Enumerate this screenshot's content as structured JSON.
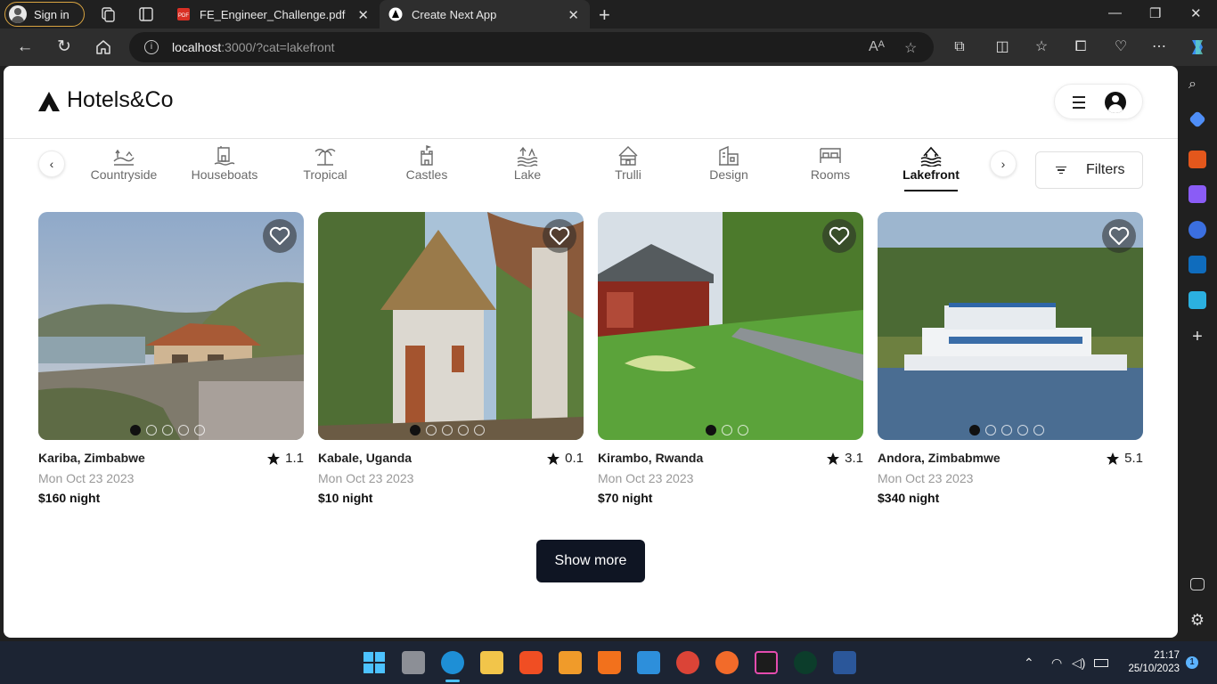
{
  "browser": {
    "signin_label": "Sign in",
    "tabs": [
      {
        "title": "FE_Engineer_Challenge.pdf",
        "icon": "pdf-icon"
      },
      {
        "title": "Create Next App",
        "icon": "nextjs-icon",
        "active": true
      }
    ],
    "url_host": "localhost",
    "url_rest": ":3000/?cat=lakefront"
  },
  "site": {
    "logo_text": "Hotels&Co",
    "filters_label": "Filters",
    "show_more_label": "Show more",
    "categories": [
      {
        "label": "Countryside",
        "icon": "countryside-icon"
      },
      {
        "label": "Houseboats",
        "icon": "houseboat-icon"
      },
      {
        "label": "Tropical",
        "icon": "palm-tree-icon"
      },
      {
        "label": "Castles",
        "icon": "castle-icon"
      },
      {
        "label": "Lake",
        "icon": "lake-icon"
      },
      {
        "label": "Trulli",
        "icon": "trulli-icon"
      },
      {
        "label": "Design",
        "icon": "design-icon"
      },
      {
        "label": "Rooms",
        "icon": "bed-icon"
      },
      {
        "label": "Lakefront",
        "icon": "lakefront-icon",
        "active": true
      }
    ],
    "listings": [
      {
        "location": "Kariba, Zimbabwe",
        "rating": "1.1",
        "date": "Mon Oct 23 2023",
        "price": "$160 night"
      },
      {
        "location": "Kabale, Uganda",
        "rating": "0.1",
        "date": "Mon Oct 23 2023",
        "price": "$10 night"
      },
      {
        "location": "Kirambo, Rwanda",
        "rating": "3.1",
        "date": "Mon Oct 23 2023",
        "price": "$70 night"
      },
      {
        "location": "Andora, Zimbabmwe",
        "rating": "5.1",
        "date": "Mon Oct 23 2023",
        "price": "$340 night"
      }
    ]
  },
  "taskbar": {
    "time": "21:17",
    "date": "25/10/2023",
    "notifications": "1"
  }
}
